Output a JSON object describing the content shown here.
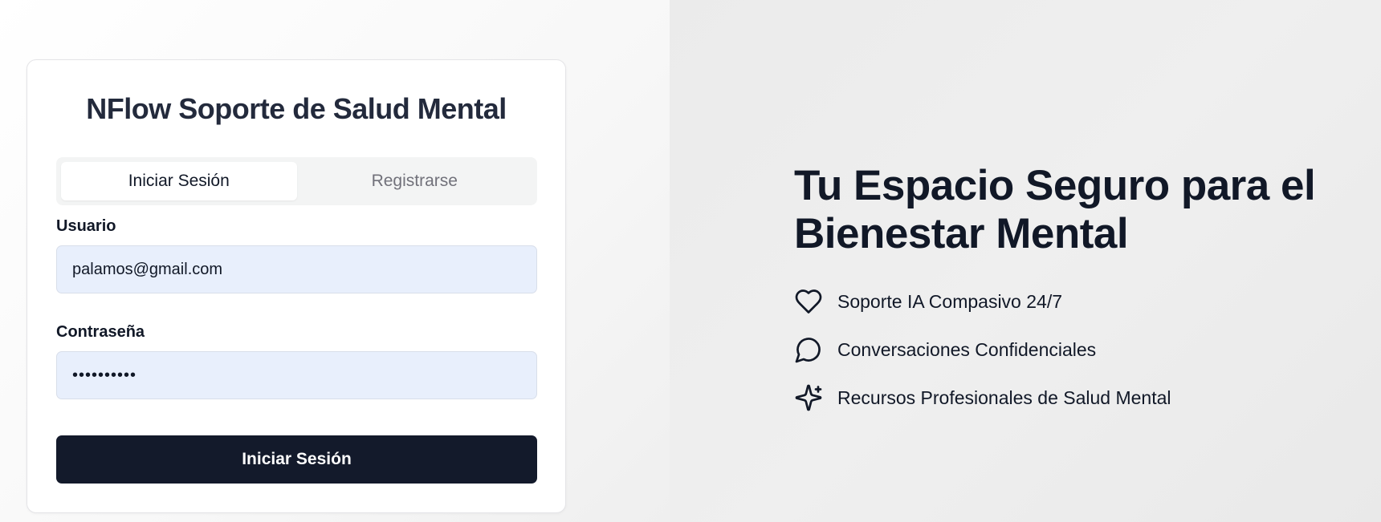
{
  "app": {
    "title": "NFlow Soporte de Salud Mental"
  },
  "auth": {
    "tabs": [
      {
        "label": "Iniciar Sesión",
        "active": true
      },
      {
        "label": "Registrarse",
        "active": false
      }
    ],
    "username": {
      "label": "Usuario",
      "value": "palamos@gmail.com"
    },
    "password": {
      "label": "Contraseña",
      "value": "••••••••••"
    },
    "submit_label": "Iniciar Sesión"
  },
  "hero": {
    "title_line1": "Tu Espacio Seguro para el",
    "title_line2": "Bienestar Mental",
    "features": [
      {
        "icon": "heart-icon",
        "text": "Soporte IA Compasivo 24/7"
      },
      {
        "icon": "chat-bubble-icon",
        "text": "Conversaciones Confidenciales"
      },
      {
        "icon": "sparkles-icon",
        "text": "Recursos Profesionales de Salud Mental"
      }
    ]
  },
  "colors": {
    "primary": "#131a2b",
    "input_bg": "#e8effc",
    "text": "#111827"
  }
}
